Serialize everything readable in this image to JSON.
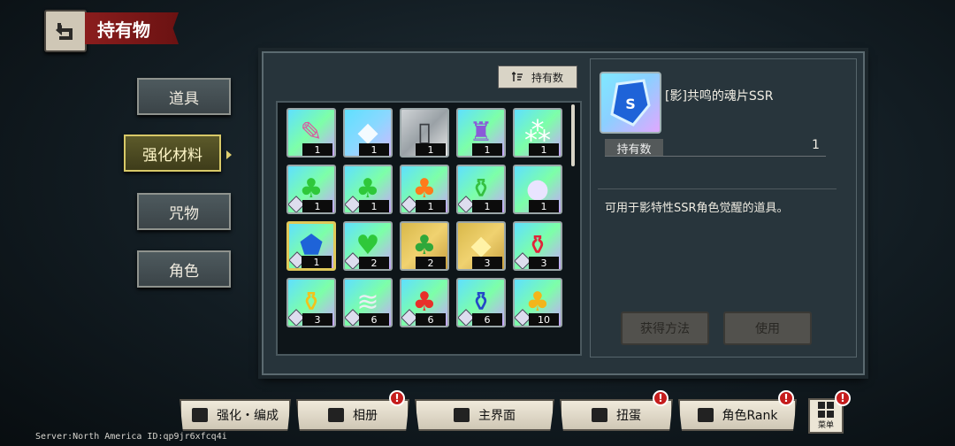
{
  "header": {
    "title": "持有物",
    "back_icon": "back-arrow-icon"
  },
  "categories": [
    {
      "label": "道具"
    },
    {
      "label": "强化材料",
      "active": true
    },
    {
      "label": "咒物"
    },
    {
      "label": "角色"
    }
  ],
  "toolbar": {
    "sort_label": "持有数",
    "sort_icon": "sort-icon"
  },
  "items": [
    {
      "icon": "crystal-shard-icon",
      "count": "1",
      "colors": [
        "#5fe0ff",
        "#7dffa8",
        "#c9a3ff"
      ]
    },
    {
      "icon": "white-crystal-icon",
      "count": "1",
      "colors": [
        "#5fe0ff",
        "#8ad8ff",
        "#d0b8ff"
      ]
    },
    {
      "icon": "mirror-icon",
      "count": "1",
      "colors": [
        "#cfd3d6",
        "#9aa1a6",
        "#e8e8e8"
      ]
    },
    {
      "icon": "statue-icon",
      "count": "1",
      "colors": [
        "#5fe0ff",
        "#7dffa8",
        "#c9a3ff"
      ]
    },
    {
      "icon": "shards-icon",
      "count": "1",
      "colors": [
        "#5fe0ff",
        "#7dffa8",
        "#c9a3ff"
      ]
    },
    {
      "icon": "green-flame-icon",
      "count": "1",
      "colors": [
        "#5fe0ff",
        "#7dffa8",
        "#c9a3ff"
      ]
    },
    {
      "icon": "green-flame-club-icon",
      "count": "1",
      "colors": [
        "#5fe0ff",
        "#7dffa8",
        "#c9a3ff"
      ]
    },
    {
      "icon": "orange-flame-club-icon",
      "count": "1",
      "colors": [
        "#5fe0ff",
        "#7dffa8",
        "#c9a3ff"
      ]
    },
    {
      "icon": "green-potion-icon",
      "count": "1",
      "colors": [
        "#5fe0ff",
        "#7dffa8",
        "#c9a3ff"
      ]
    },
    {
      "icon": "orb-icon",
      "count": "1",
      "colors": [
        "#5fe0ff",
        "#7dffa8",
        "#c9a3ff"
      ]
    },
    {
      "icon": "blue-soul-shard-icon",
      "count": "1",
      "colors": [
        "#5fe0ff",
        "#7dffa8",
        "#c9a3ff"
      ],
      "selected": true
    },
    {
      "icon": "green-flame-heart-icon",
      "count": "2",
      "colors": [
        "#5fe0ff",
        "#7dffa8",
        "#c9a3ff"
      ]
    },
    {
      "icon": "gold-flame-icon",
      "count": "2",
      "colors": [
        "#d8b84a",
        "#f0d270",
        "#c8a040"
      ]
    },
    {
      "icon": "gold-crystal-icon",
      "count": "3",
      "colors": [
        "#d8b84a",
        "#f0d270",
        "#c8a040"
      ]
    },
    {
      "icon": "red-potion-icon",
      "count": "3",
      "colors": [
        "#5fe0ff",
        "#7dffa8",
        "#c9a3ff"
      ]
    },
    {
      "icon": "yellow-potion-icon",
      "count": "3",
      "colors": [
        "#5fe0ff",
        "#7dffa8",
        "#c9a3ff"
      ]
    },
    {
      "icon": "silver-shards-icon",
      "count": "6",
      "colors": [
        "#5fe0ff",
        "#7dffa8",
        "#c9a3ff"
      ]
    },
    {
      "icon": "red-flame-icon",
      "count": "6",
      "colors": [
        "#5fe0ff",
        "#7dffa8",
        "#c9a3ff"
      ]
    },
    {
      "icon": "blue-potion-icon",
      "count": "6",
      "colors": [
        "#5fe0ff",
        "#7dffa8",
        "#c9a3ff"
      ]
    },
    {
      "icon": "yellow-flame-icon",
      "count": "10",
      "colors": [
        "#5fe0ff",
        "#7dffa8",
        "#c9a3ff"
      ]
    }
  ],
  "detail": {
    "name": "[影]共鸣的魂片SSR",
    "owned_label": "持有数",
    "owned_value": "1",
    "description": "可用于影特性SSR角色觉醒的道具。",
    "acquire_label": "获得方法",
    "use_label": "使用"
  },
  "nav": [
    {
      "label": "强化・编成",
      "icon": "team-icon",
      "alert": false
    },
    {
      "label": "相册",
      "icon": "album-icon",
      "alert": true
    },
    {
      "label": "主界面",
      "icon": "home-icon",
      "alert": false
    },
    {
      "label": "扭蛋",
      "icon": "gacha-icon",
      "alert": true
    },
    {
      "label": "角色Rank",
      "icon": "character-card-icon",
      "alert": true
    }
  ],
  "menu": {
    "label": "菜单",
    "alert": true
  },
  "alert_mark": "!",
  "server": "Server:North America ID:qp9jr6xfcq4i"
}
